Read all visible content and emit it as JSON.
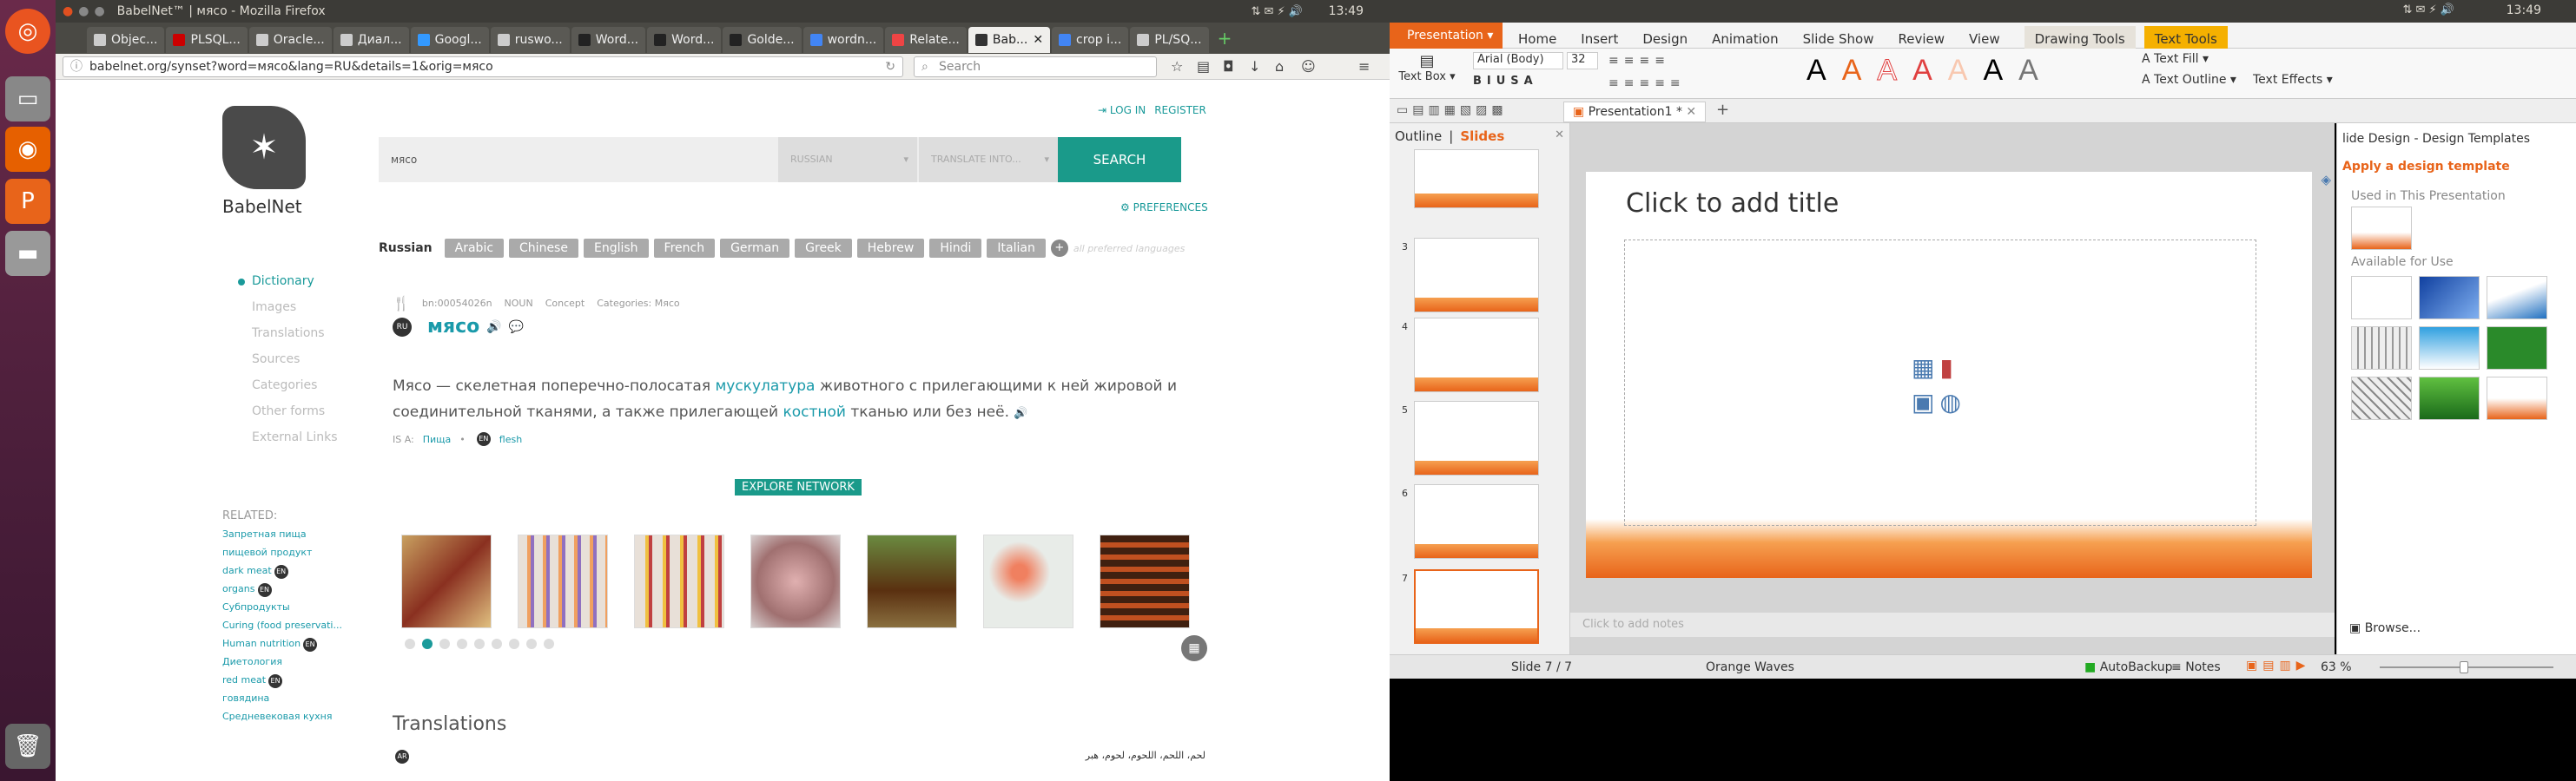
{
  "system": {
    "ff_window_title": "BabelNet™ | мясо - Mozilla Firefox",
    "clock": "13:49"
  },
  "firefox": {
    "tabs": [
      "Objec...",
      "PLSQL...",
      "Oracle...",
      "Диал...",
      "Googl...",
      "ruswo...",
      "Word...",
      "Word...",
      "Golde...",
      "wordn...",
      "Relate...",
      "Bab...",
      "crop i...",
      "PL/SQ..."
    ],
    "url": "babelnet.org/synset?word=мясо&lang=RU&details=1&orig=мясо",
    "search_placeholder": "Search"
  },
  "babelnet": {
    "logo": "BabelNet",
    "login": "LOG IN",
    "register": "REGISTER",
    "query": "мясо",
    "lang_from": "RUSSIAN",
    "lang_to": "TRANSLATE INTO...",
    "search_btn": "SEARCH",
    "preferences": "PREFERENCES",
    "current_lang": "Russian",
    "languages": [
      "Arabic",
      "Chinese",
      "English",
      "French",
      "German",
      "Greek",
      "Hebrew",
      "Hindi",
      "Italian"
    ],
    "all_langs": "all preferred languages",
    "nav": [
      "Dictionary",
      "Images",
      "Translations",
      "Sources",
      "Categories",
      "Other forms",
      "External Links"
    ],
    "related_label": "RELATED:",
    "related": [
      {
        "t": "Запретная пища",
        "en": false
      },
      {
        "t": "пищевой продукт",
        "en": false
      },
      {
        "t": "dark meat",
        "en": true
      },
      {
        "t": "organs",
        "en": true
      },
      {
        "t": "Субпродукты",
        "en": false
      },
      {
        "t": "Curing (food preservati...",
        "en": false
      },
      {
        "t": "Human nutrition",
        "en": true
      },
      {
        "t": "Диетология",
        "en": false
      },
      {
        "t": "red meat",
        "en": true
      },
      {
        "t": "говядина",
        "en": false
      },
      {
        "t": "Средневековая кухня",
        "en": false
      }
    ],
    "en_badge": "EN",
    "meta": {
      "id": "bn:00054026n",
      "pos": "NOUN",
      "kind": "Concept",
      "cats": "Categories: Мясо"
    },
    "ru_badge": "RU",
    "word": "мясо",
    "gloss_a": "Мясо  — скелетная поперечно-полосатая ",
    "gloss_link1": "мускулатура",
    "gloss_b": " животного с прилегающими к ней жировой и соединительной тканями, а также прилегающей ",
    "gloss_link2": "костной",
    "gloss_c": " тканью или без неё.",
    "isa_label": "IS A:",
    "isa1": "Пища",
    "isa2": "flesh",
    "explore": "EXPLORE NETWORK",
    "translations_h": "Translations",
    "ar_badge": "AR",
    "ar_text": "لحم، اللحم، اللحوم، لحوم، هبر"
  },
  "wps": {
    "app": "Presentation",
    "menus": [
      "Home",
      "Insert",
      "Design",
      "Animation",
      "Slide Show",
      "Review",
      "View"
    ],
    "ctx_draw": "Drawing Tools",
    "ctx_text": "Text Tools",
    "text_box": "Text Box",
    "font": "Arial (Body)",
    "size": "32",
    "text_fill": "Text Fill",
    "text_outline": "Text Outline",
    "text_effects": "Text Effects",
    "doc": "Presentation1 *",
    "outline_tab": "Outline",
    "slides_tab": "Slides",
    "slide_nums": [
      "3",
      "4",
      "5",
      "6",
      "7"
    ],
    "title_ph": "Click to add title",
    "notes_ph": "Click to add notes",
    "pane_title": "lide Design - Design Templates",
    "apply": "Apply a design template",
    "used": "Used in This Presentation",
    "available": "Available for Use",
    "browse": "Browse...",
    "status_slide": "Slide 7 / 7",
    "status_theme": "Orange Waves",
    "autobackup": "AutoBackup",
    "notes": "Notes",
    "zoom": "63 %"
  }
}
